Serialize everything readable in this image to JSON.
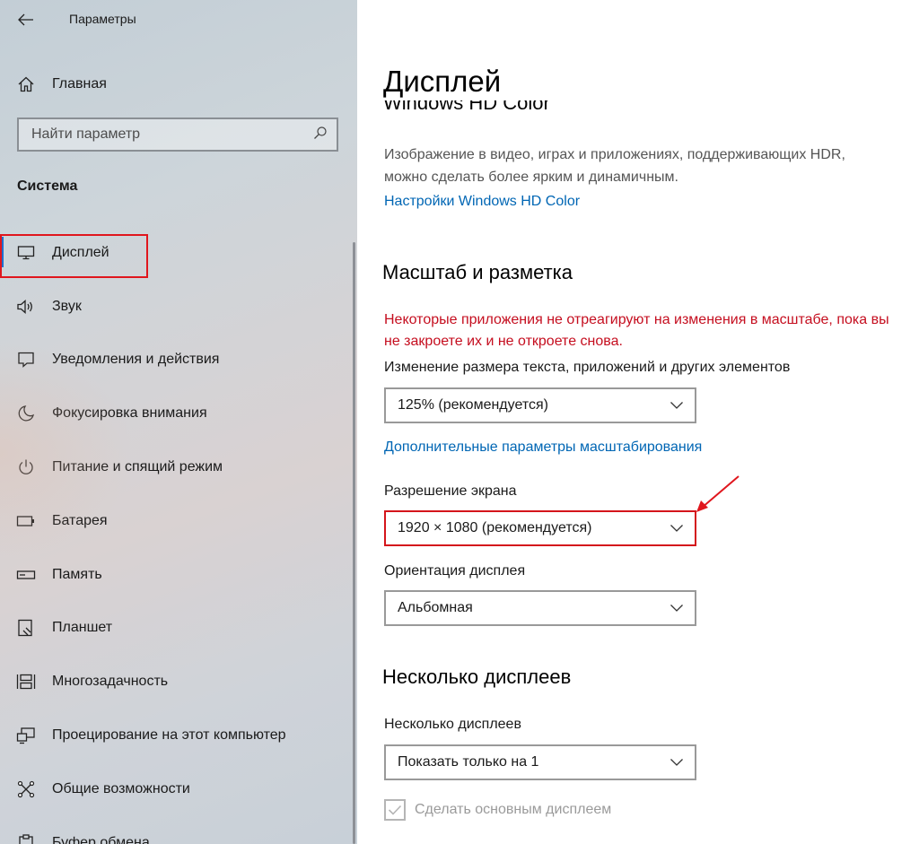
{
  "window": {
    "title": "Параметры"
  },
  "sidebar": {
    "home_label": "Главная",
    "search_placeholder": "Найти параметр",
    "section_title": "Система",
    "items": [
      {
        "label": "Дисплей",
        "icon": "monitor-icon",
        "active": true
      },
      {
        "label": "Звук",
        "icon": "speaker-icon"
      },
      {
        "label": "Уведомления и действия",
        "icon": "notification-icon"
      },
      {
        "label": "Фокусировка внимания",
        "icon": "moon-icon"
      },
      {
        "label": "Питание и спящий режим",
        "icon": "power-icon"
      },
      {
        "label": "Батарея",
        "icon": "battery-icon"
      },
      {
        "label": "Память",
        "icon": "storage-icon"
      },
      {
        "label": "Планшет",
        "icon": "tablet-icon"
      },
      {
        "label": "Многозадачность",
        "icon": "multitasking-icon"
      },
      {
        "label": "Проецирование на этот компьютер",
        "icon": "projecting-icon"
      },
      {
        "label": "Общие возможности",
        "icon": "shared-experiences-icon"
      },
      {
        "label": "Буфер обмена",
        "icon": "clipboard-icon"
      }
    ]
  },
  "main": {
    "page_title": "Дисплей",
    "hd_color": {
      "heading": "Windows HD Color",
      "description": "Изображение в видео, играх и приложениях, поддерживающих HDR, можно сделать более ярким и динамичным.",
      "link": "Настройки Windows HD Color"
    },
    "scale": {
      "heading": "Масштаб и разметка",
      "warning": "Некоторые приложения не отреагируют на изменения в масштабе, пока вы не закроете их и не откроете снова.",
      "size_label": "Изменение размера текста, приложений и других элементов",
      "size_value": "125% (рекомендуется)",
      "advanced_link": "Дополнительные параметры масштабирования",
      "resolution_label": "Разрешение экрана",
      "resolution_value": "1920 × 1080 (рекомендуется)",
      "orientation_label": "Ориентация дисплея",
      "orientation_value": "Альбомная"
    },
    "multi": {
      "heading": "Несколько дисплеев",
      "label": "Несколько дисплеев",
      "value": "Показать только на 1",
      "checkbox_label": "Сделать основным дисплеем",
      "checkbox_checked": true
    }
  },
  "colors": {
    "accent": "#1f6fce",
    "link": "#0066b4",
    "warning": "#c50e1f",
    "annotation": "#e0161d"
  }
}
